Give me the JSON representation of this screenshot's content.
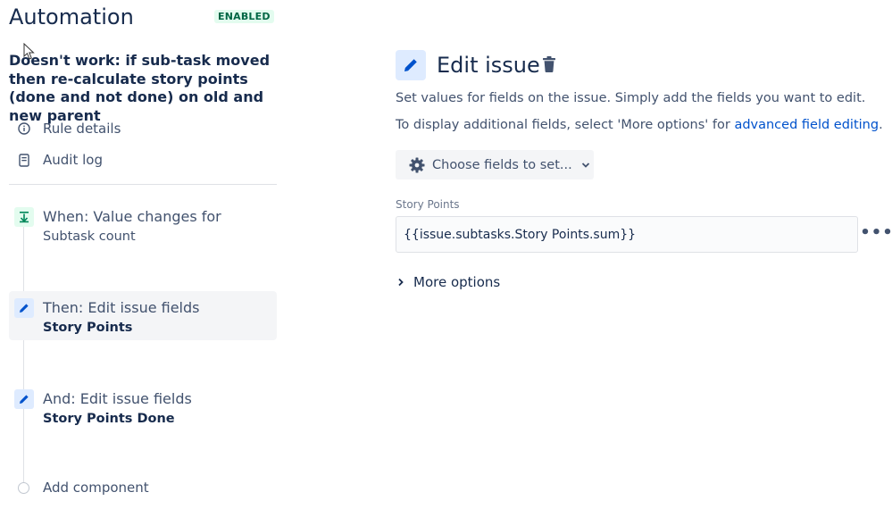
{
  "header": {
    "title": "Automation",
    "status_badge": "ENABLED"
  },
  "rule": {
    "title": "Doesn't work: if sub-task moved then re-calculate story points (done and not done) on old and new parent"
  },
  "nav": {
    "rule_details": "Rule details",
    "audit_log": "Audit log"
  },
  "components": {
    "trigger": {
      "label": "When: Value changes for",
      "detail": "Subtask count"
    },
    "action1": {
      "label": "Then: Edit issue fields",
      "detail": "Story Points"
    },
    "action2": {
      "label": "And: Edit issue fields",
      "detail": "Story Points Done"
    },
    "add_label": "Add component"
  },
  "editor": {
    "title": "Edit issue",
    "description": "Set values for fields on the issue. Simply add the fields you want to edit.",
    "advanced_prefix": "To display additional fields, select 'More options' for ",
    "advanced_link": "advanced field editing",
    "advanced_suffix": ".",
    "choose_fields": "Choose fields to set...",
    "field_label": "Story Points",
    "field_value": "{{issue.subtasks.Story Points.sum}}",
    "more_dots": "•••",
    "more_options": "More options"
  },
  "colors": {
    "accent_blue": "#0052cc",
    "enabled_green": "#006644",
    "text_dark": "#172b4d"
  }
}
